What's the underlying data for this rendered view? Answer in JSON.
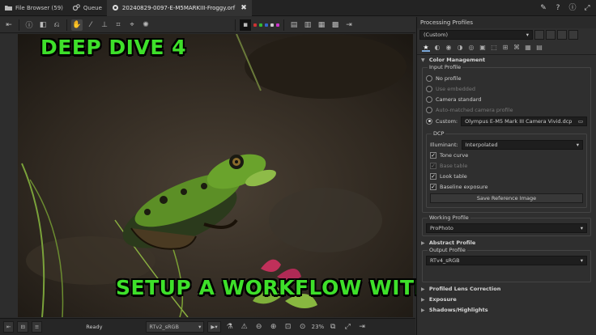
{
  "tabs": [
    {
      "label": "File Browser (59)",
      "icon": "folder-icon"
    },
    {
      "label": "Queue",
      "icon": "gears-icon"
    },
    {
      "label": "20240829-0097-E-M5MARKIII-Froggy.orf",
      "icon": "editor-icon"
    }
  ],
  "statusbar": {
    "ready": "Ready",
    "output_profile": "RTv2_sRGB",
    "zoom": "23%"
  },
  "panel": {
    "title": "Processing Profiles",
    "profile": "(Custom)",
    "color_management": "Color Management",
    "input_profile": {
      "title": "Input Profile",
      "options": [
        {
          "label": "No profile",
          "selected": false,
          "enabled": true
        },
        {
          "label": "Use embedded",
          "selected": false,
          "enabled": false
        },
        {
          "label": "Camera standard",
          "selected": false,
          "enabled": true
        },
        {
          "label": "Auto-matched camera profile",
          "selected": false,
          "enabled": false
        }
      ],
      "custom_label": "Custom:",
      "custom_value": "Olympus E-M5 Mark III Camera Vivid.dcp"
    },
    "dcp": {
      "title": "DCP",
      "illuminant_label": "Illuminant:",
      "illuminant_value": "Interpolated",
      "checks": [
        {
          "label": "Tone curve",
          "checked": true,
          "enabled": true
        },
        {
          "label": "Base table",
          "checked": true,
          "enabled": false
        },
        {
          "label": "Look table",
          "checked": true,
          "enabled": true
        },
        {
          "label": "Baseline exposure",
          "checked": true,
          "enabled": true
        }
      ],
      "save_button": "Save Reference Image"
    },
    "working_profile": {
      "title": "Working Profile",
      "value": "ProPhoto"
    },
    "abstract_profile": "Abstract Profile",
    "output_profile": {
      "title": "Output Profile",
      "value": "RTv4_sRGB"
    },
    "sections": [
      "Profiled Lens Correction",
      "Exposure",
      "Shadows/Highlights"
    ]
  },
  "overlay": {
    "top": "DEEP DIVE 4",
    "bottom": "SETUP A WORKFLOW WITH FAVORITES"
  },
  "colors": {
    "overlay_green": "#3ee02a",
    "accent": "#7aa7d7"
  }
}
